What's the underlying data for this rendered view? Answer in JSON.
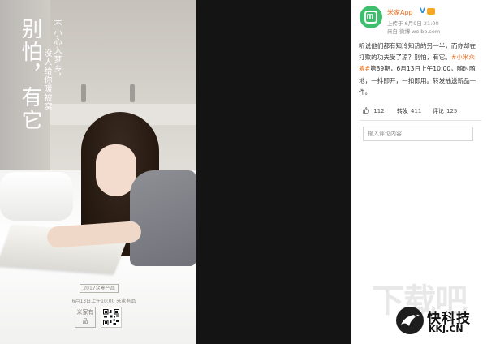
{
  "poster": {
    "headline": "别怕，有它",
    "subline_1": "不小心入梦乡，",
    "subline_2": "没人给你暖被窝",
    "tag": "2017众筹产品",
    "date_line": "6月13日上午10:00 米家有品",
    "brand": "米家有品"
  },
  "weibo": {
    "username": "米家App",
    "verified_mark": "V",
    "posted_time": "上传于 6月9日 21:00",
    "source": "来自 微博 weibo.com",
    "post": {
      "part1": "听说他们都有知冷知热的另一半，而你却在打败的功夫受了凉？别怕，有它。",
      "hashtag": "#小米众筹#",
      "part2": "第89期，6月13日上午10:00，随时随地，一抖即开，一扣即用。转发抽送新品一件。"
    },
    "actions": {
      "like_count": "112",
      "repost_label": "转发",
      "repost_count": "411",
      "comment_label": "评论",
      "comment_count": "125"
    },
    "comment_placeholder": "输入评论内容"
  },
  "watermark": {
    "ghost": "下载吧",
    "name": "快科技",
    "url": "KKJ.CN"
  },
  "colors": {
    "accent_orange": "#e86c1d",
    "verified_blue": "#2d8fd5",
    "mijia_green": "#3dbf6e"
  },
  "icons": [
    "thumbs-up-icon",
    "mijia-logo-icon",
    "qr-code-icon",
    "kkj-logo-icon"
  ]
}
